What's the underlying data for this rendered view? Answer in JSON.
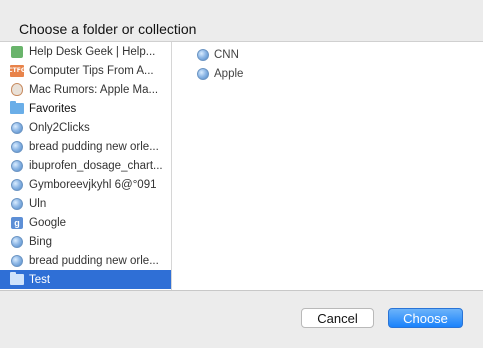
{
  "dialog": {
    "title": "Choose a folder or collection"
  },
  "sidebar": {
    "items": [
      {
        "label": "Help Desk Geek | Help...",
        "icon": "green-square-icon"
      },
      {
        "label": "Computer Tips From A...",
        "icon": "ctfg-icon",
        "icon_text": "CTFG"
      },
      {
        "label": "Mac Rumors: Apple Ma...",
        "icon": "apple-icon"
      },
      {
        "label": "Favorites",
        "icon": "folder-icon"
      },
      {
        "label": "Only2Clicks",
        "icon": "globe-icon"
      },
      {
        "label": "bread pudding new orle...",
        "icon": "globe-icon"
      },
      {
        "label": "ibuprofen_dosage_chart...",
        "icon": "globe-icon"
      },
      {
        "label": "Gymboreevjkyhl 6@°091",
        "icon": "globe-icon"
      },
      {
        "label": "Uln",
        "icon": "globe-icon"
      },
      {
        "label": "Google",
        "icon": "google-icon",
        "icon_text": "g"
      },
      {
        "label": "Bing",
        "icon": "globe-icon"
      },
      {
        "label": "bread pudding new orle...",
        "icon": "globe-icon"
      },
      {
        "label": "Test",
        "icon": "folder-icon",
        "selected": true
      }
    ]
  },
  "main": {
    "items": [
      {
        "label": "CNN",
        "icon": "globe-icon"
      },
      {
        "label": "Apple",
        "icon": "globe-icon"
      }
    ]
  },
  "buttons": {
    "cancel_label": "Cancel",
    "choose_label": "Choose"
  },
  "colors": {
    "selection": "#2f6fd6",
    "primary_button": "#1a82fb",
    "folder": "#6aaee8"
  }
}
